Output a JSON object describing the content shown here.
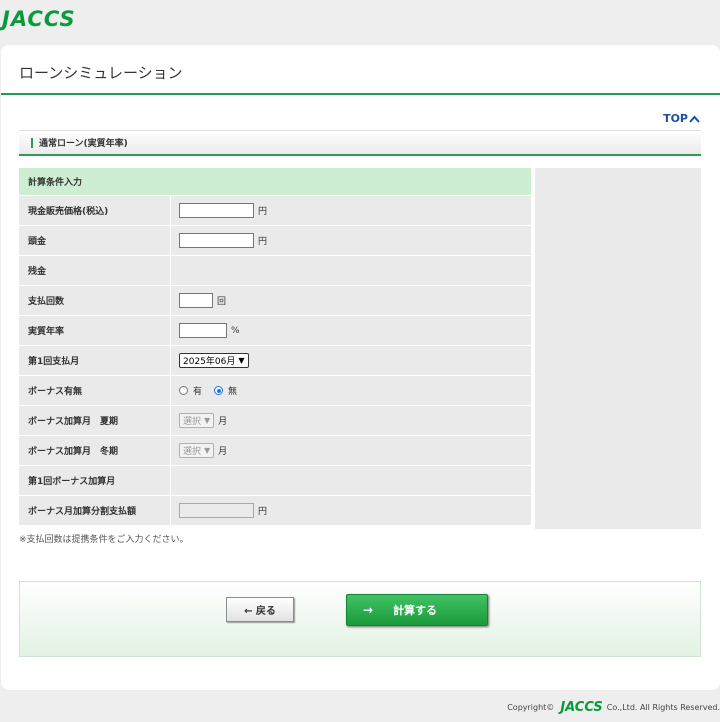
{
  "logo": "JACCS",
  "page_title": "ローンシミュレーション",
  "top_link": "TOP",
  "section_title": "通常ローン(実質年率)",
  "form": {
    "header": "計算条件入力",
    "rows": [
      {
        "label": "現金販売価格(税込)",
        "unit": "円",
        "value": ""
      },
      {
        "label": "頭金",
        "unit": "円",
        "value": ""
      },
      {
        "label": "残金"
      },
      {
        "label": "支払回数",
        "unit": "回",
        "value": ""
      },
      {
        "label": "実質年率",
        "unit": "%",
        "value": ""
      },
      {
        "label": "第1回支払月",
        "select": "2025年06月"
      },
      {
        "label": "ボーナス有無",
        "options": [
          "有",
          "無"
        ],
        "selected": "無"
      },
      {
        "label": "ボーナス加算月　夏期",
        "select": "選択",
        "unit": "月"
      },
      {
        "label": "ボーナス加算月　冬期",
        "select": "選択",
        "unit": "月"
      },
      {
        "label": "第1回ボーナス加算月"
      },
      {
        "label": "ボーナス月加算分割支払額",
        "unit": "円",
        "value": ""
      }
    ]
  },
  "note": "※支払回数は提携条件をご入力ください。",
  "buttons": {
    "back": "← 戻る",
    "calculate": "計算する",
    "calculate_arrow": "→"
  },
  "footer": {
    "copyright": "Copyright©",
    "company_logo": "JACCS",
    "rights": "Co.,Ltd. All Rights Reserved."
  },
  "colors": {
    "brand_green": "#0a9a3c",
    "accent_rule": "#24975a",
    "form_header_bg": "#cdeed3",
    "link_blue": "#1d4f9e"
  }
}
